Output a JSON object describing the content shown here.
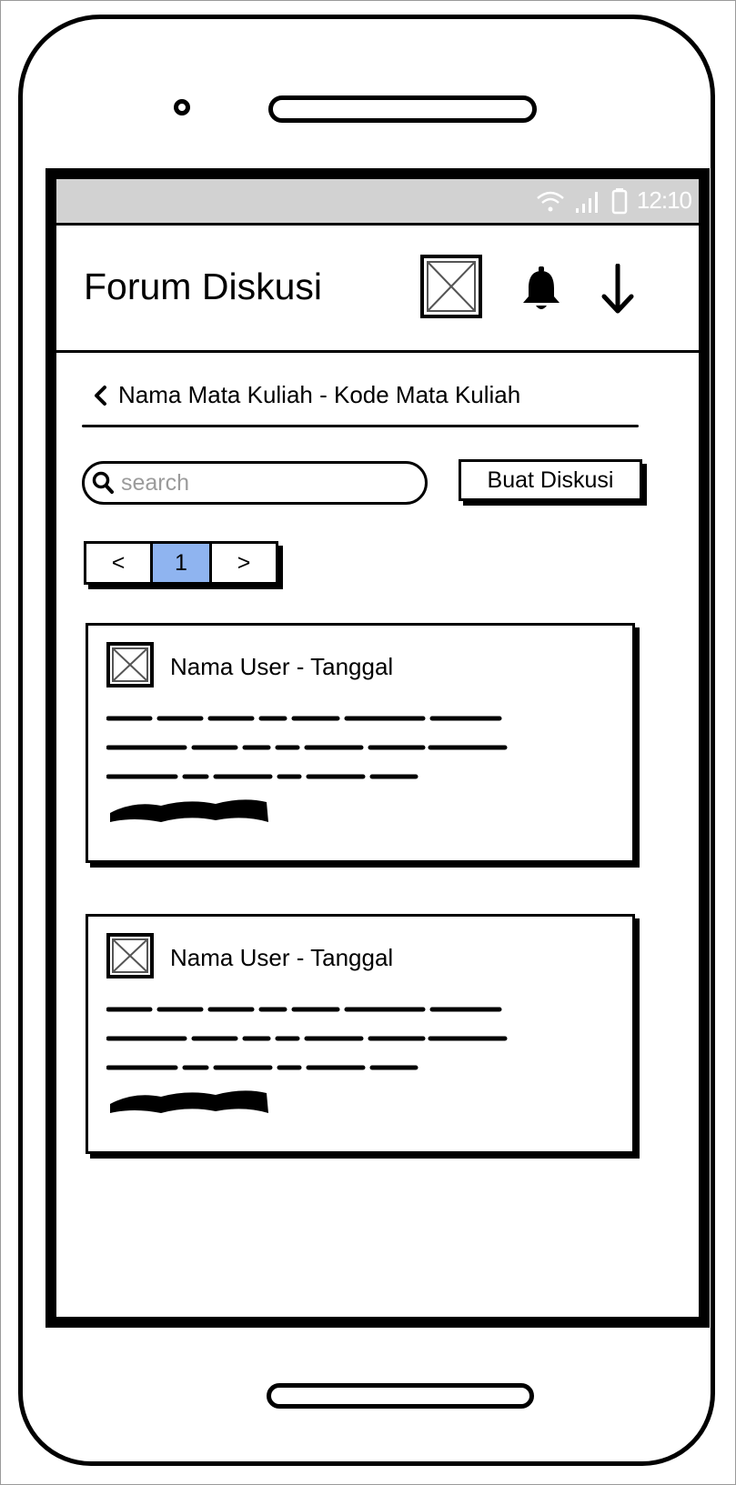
{
  "status_bar": {
    "time": "12:10",
    "icons": [
      "wifi-icon",
      "signal-icon",
      "battery-icon"
    ]
  },
  "header": {
    "title": "Forum Diskusi",
    "icons": [
      "image-placeholder-icon",
      "bell-icon",
      "arrow-down-icon"
    ]
  },
  "breadcrumb": {
    "label": "Nama Mata Kuliah - Kode Mata Kuliah"
  },
  "search": {
    "placeholder": "search"
  },
  "create_button": {
    "label": "Buat Diskusi"
  },
  "pagination": {
    "prev": "<",
    "current": "1",
    "next": ">"
  },
  "posts": [
    {
      "author": "Nama User - Tanggal"
    },
    {
      "author": "Nama User - Tanggal"
    }
  ],
  "colors": {
    "status_bar": "#d2d2d2",
    "pager_active": "#8fb4f0",
    "placeholder": "#9b9b9b"
  }
}
